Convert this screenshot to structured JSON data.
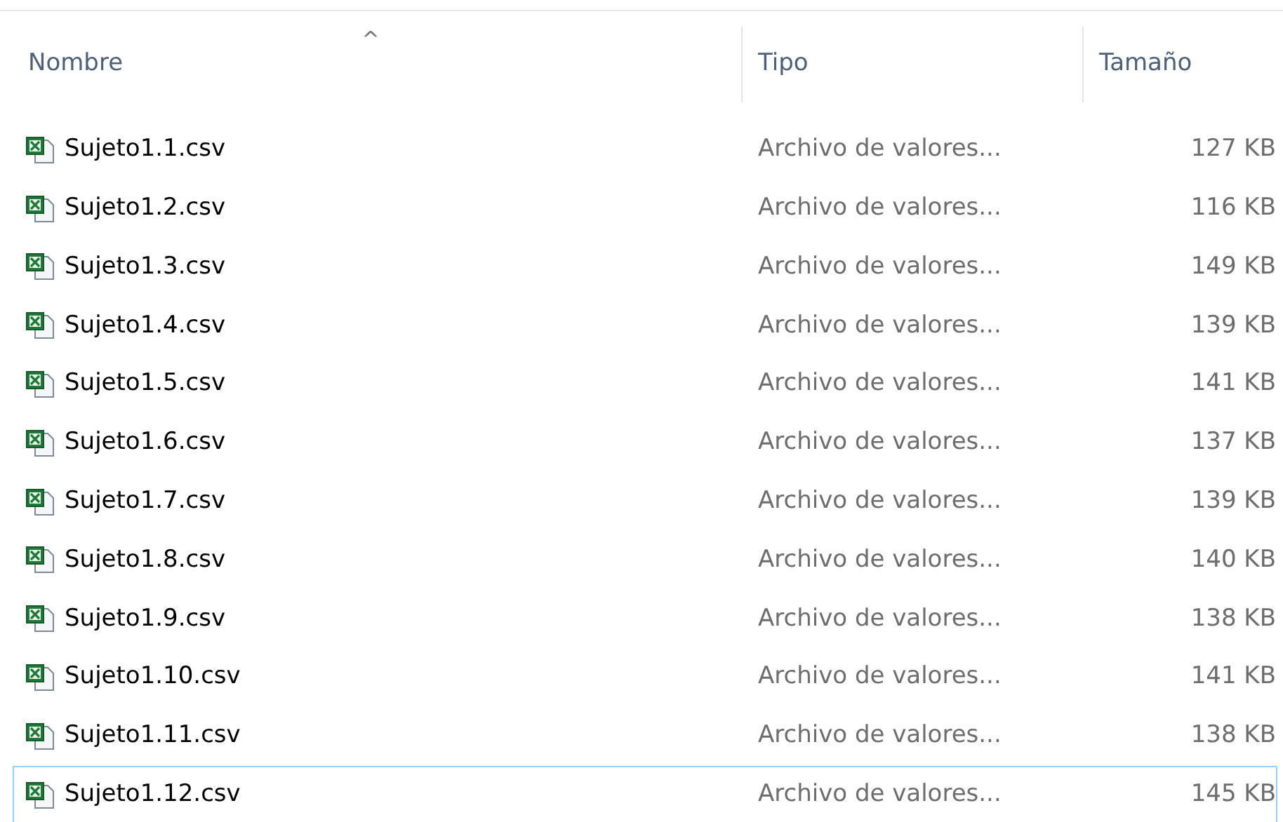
{
  "columns": [
    {
      "label": "Nombre",
      "sorted": true
    },
    {
      "label": "Tipo",
      "sorted": false
    },
    {
      "label": "Tamaño",
      "sorted": false
    }
  ],
  "sort_indicator": "^",
  "rows": [
    {
      "name": "Sujeto1.1.csv",
      "type": "Archivo de valores...",
      "size": "127 KB",
      "focused": false
    },
    {
      "name": "Sujeto1.2.csv",
      "type": "Archivo de valores...",
      "size": "116 KB",
      "focused": false
    },
    {
      "name": "Sujeto1.3.csv",
      "type": "Archivo de valores...",
      "size": "149 KB",
      "focused": false
    },
    {
      "name": "Sujeto1.4.csv",
      "type": "Archivo de valores...",
      "size": "139 KB",
      "focused": false
    },
    {
      "name": "Sujeto1.5.csv",
      "type": "Archivo de valores...",
      "size": "141 KB",
      "focused": false
    },
    {
      "name": "Sujeto1.6.csv",
      "type": "Archivo de valores...",
      "size": "137 KB",
      "focused": false
    },
    {
      "name": "Sujeto1.7.csv",
      "type": "Archivo de valores...",
      "size": "139 KB",
      "focused": false
    },
    {
      "name": "Sujeto1.8.csv",
      "type": "Archivo de valores...",
      "size": "140 KB",
      "focused": false
    },
    {
      "name": "Sujeto1.9.csv",
      "type": "Archivo de valores...",
      "size": "138 KB",
      "focused": false
    },
    {
      "name": "Sujeto1.10.csv",
      "type": "Archivo de valores...",
      "size": "141 KB",
      "focused": false
    },
    {
      "name": "Sujeto1.11.csv",
      "type": "Archivo de valores...",
      "size": "138 KB",
      "focused": false
    },
    {
      "name": "Sujeto1.12.csv",
      "type": "Archivo de valores...",
      "size": "145 KB",
      "focused": true
    }
  ]
}
